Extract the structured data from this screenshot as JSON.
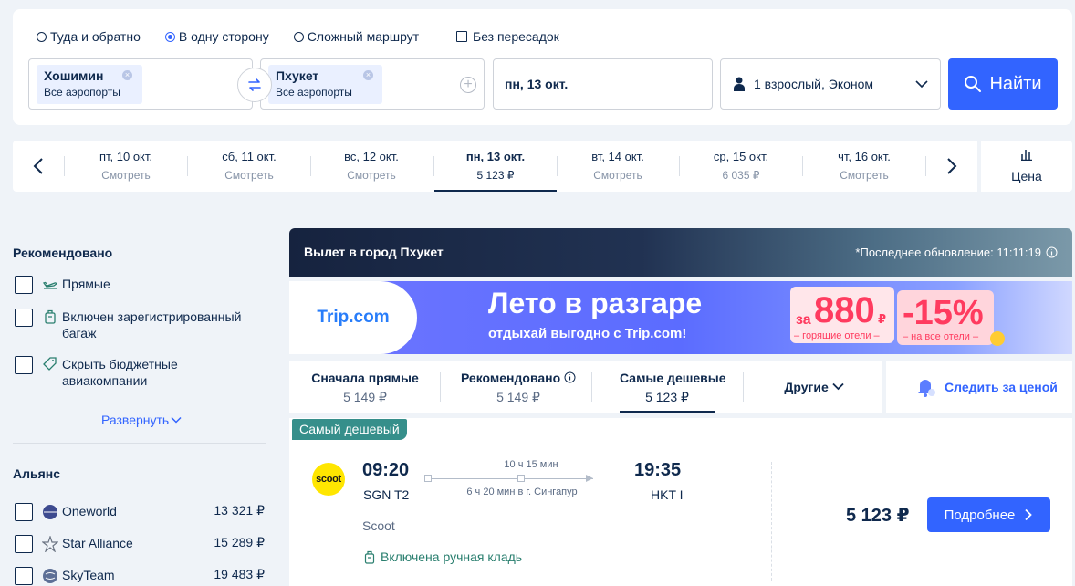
{
  "search": {
    "trip_types": [
      {
        "label": "Туда и обратно",
        "checked": false
      },
      {
        "label": "В одну сторону",
        "checked": true
      },
      {
        "label": "Сложный маршрут",
        "checked": false
      }
    ],
    "direct_only_label": "Без пересадок",
    "from": {
      "city": "Хошимин",
      "sub": "Все аэропорты"
    },
    "to": {
      "city": "Пхукет",
      "sub": "Все аэропорты"
    },
    "date": "пн, 13 окт.",
    "passengers": "1 взрослый, Эконом",
    "search_button": "Найти"
  },
  "date_strip": {
    "days": [
      {
        "label": "пт, 10 окт.",
        "sub": "Смотреть"
      },
      {
        "label": "сб, 11 окт.",
        "sub": "Смотреть"
      },
      {
        "label": "вс, 12 окт.",
        "sub": "Смотреть"
      },
      {
        "label": "пн, 13 окт.",
        "sub": "5 123 ₽"
      },
      {
        "label": "вт, 14 окт.",
        "sub": "Смотреть"
      },
      {
        "label": "ср, 15 окт.",
        "sub": "6 035 ₽"
      },
      {
        "label": "чт, 16 окт.",
        "sub": "Смотреть"
      }
    ],
    "selected_index": 3,
    "price_tab_label": "Цена"
  },
  "filters": {
    "recommended_title": "Рекомендовано",
    "recommended": [
      {
        "label": "Прямые",
        "icon": "plane-icon"
      },
      {
        "label": "Включен зарегистрированный багаж",
        "icon": "luggage-icon"
      },
      {
        "label": "Скрыть бюджетные авиакомпании",
        "icon": "tag-icon"
      }
    ],
    "expand_label": "Развернуть",
    "alliance_title": "Альянс",
    "alliances": [
      {
        "label": "Oneworld",
        "price": "13 321 ₽"
      },
      {
        "label": "Star Alliance",
        "price": "15 289 ₽"
      },
      {
        "label": "SkyTeam",
        "price": "19 483 ₽"
      }
    ]
  },
  "results": {
    "header_title": "Вылет в город Пхукет",
    "last_update": "*Последнее обновление: 11:11:19",
    "banner": {
      "logo": "Trip.com",
      "title": "Лето в разгаре",
      "subtitle": "отдыхай выгодно с Trip.com!",
      "promo1_prefix": "за",
      "promo1_value": "880",
      "promo1_currency": "₽",
      "promo1_caption": "– горящие отели –",
      "promo2_value": "-15%",
      "promo2_caption": "– на все отели –"
    },
    "sort_tabs": [
      {
        "label": "Сначала прямые",
        "price": "5 149 ₽"
      },
      {
        "label": "Рекомендовано",
        "price": "5 149 ₽"
      },
      {
        "label": "Самые дешевые",
        "price": "5 123 ₽"
      }
    ],
    "sort_active_index": 2,
    "other_label": "Другие",
    "watch_price_label": "Следить за ценой",
    "flight": {
      "tag": "Самый дешевый",
      "airline_logo_text": "scoot",
      "depart_time": "09:20",
      "depart_airport": "SGN T2",
      "arrive_time": "19:35",
      "arrive_airport": "HKT I",
      "duration": "10 ч 15 мин",
      "stop_info": "6 ч 20 мин в г. Сингапур",
      "airline": "Scoot",
      "baggage": "Включена ручная кладь",
      "price": "5 123 ₽",
      "details_button": "Подробнее"
    }
  },
  "colors": {
    "accent": "#3264ff",
    "text": "#0f294d",
    "tag": "#368f8b",
    "baggage": "#2a7f6f"
  }
}
